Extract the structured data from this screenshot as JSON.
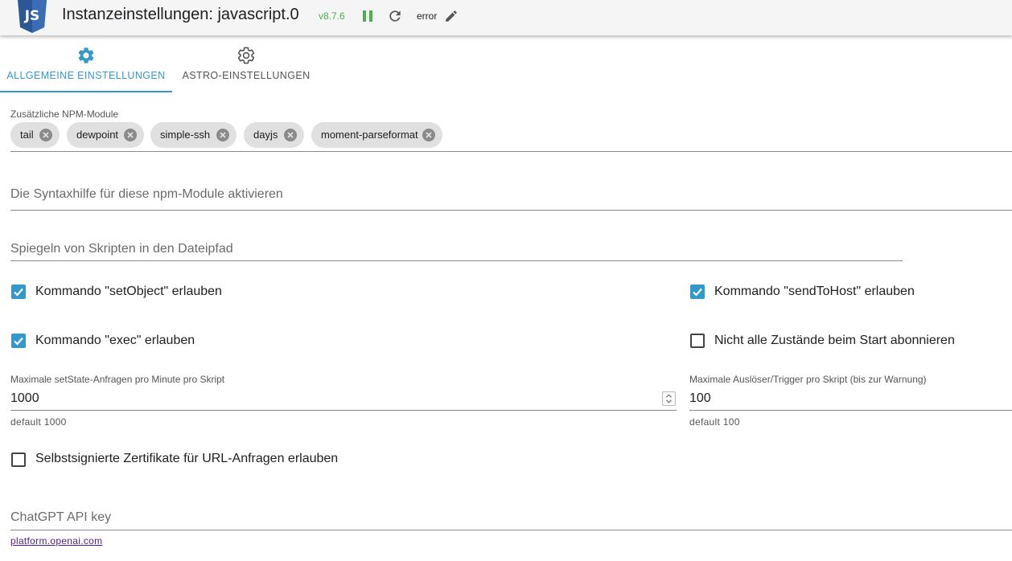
{
  "header": {
    "title": "Instanzeinstellungen: javascript.0",
    "version": "v8.7.6",
    "log_level": "error",
    "logo_text": "JS",
    "logo_color": "#2b5797",
    "version_color": "#4caf50"
  },
  "tabs": [
    {
      "label": "ALLGEMEINE EINSTELLUNGEN",
      "icon": "gear-filled-icon",
      "active": true
    },
    {
      "label": "ASTRO-EINSTELLUNGEN",
      "icon": "gear-outline-icon",
      "active": false
    }
  ],
  "accent_color": "#3399cc",
  "npm_modules": {
    "label": "Zusätzliche NPM-Module",
    "chips": [
      "tail",
      "dewpoint",
      "simple-ssh",
      "dayjs",
      "moment-parseformat"
    ]
  },
  "syntax_help": {
    "placeholder": "Die Syntaxhilfe für diese npm-Module aktivieren"
  },
  "mirror_path": {
    "placeholder": "Spiegeln von Skripten in den Dateipfad"
  },
  "checkboxes": {
    "set_object": {
      "label": "Kommando \"setObject\" erlauben",
      "checked": true
    },
    "send_to_host": {
      "label": "Kommando \"sendToHost\" erlauben",
      "checked": true
    },
    "exec": {
      "label": "Kommando \"exec\" erlauben",
      "checked": true
    },
    "no_subscribe": {
      "label": "Nicht alle Zustände beim Start abonnieren",
      "checked": false
    },
    "self_signed": {
      "label": "Selbstsignierte Zertifikate für URL-Anfragen erlauben",
      "checked": false
    }
  },
  "max_set_state": {
    "label": "Maximale setState-Anfragen pro Minute pro Skript",
    "value": "1000",
    "helper": "default 1000"
  },
  "max_triggers": {
    "label": "Maximale Auslöser/Trigger pro Skript (bis zur Warnung)",
    "value": "100",
    "helper": "default 100"
  },
  "chatgpt": {
    "placeholder": "ChatGPT API key",
    "link": "platform.openai.com"
  }
}
